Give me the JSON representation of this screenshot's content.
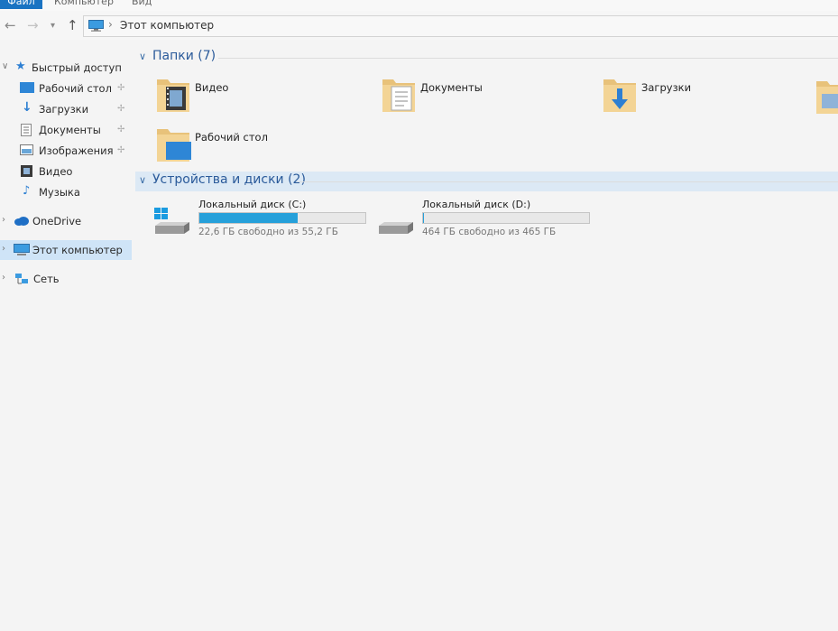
{
  "ribbon": {
    "tab_file": "Файл",
    "tab_computer": "Компьютер",
    "tab_view": "Вид"
  },
  "address": {
    "crumb": "Этот компьютер"
  },
  "nav": {
    "quick_access": "Быстрый доступ",
    "desktop": "Рабочий стол",
    "downloads": "Загрузки",
    "documents": "Документы",
    "pictures": "Изображения",
    "videos": "Видео",
    "music": "Музыка",
    "onedrive": "OneDrive",
    "this_pc": "Этот компьютер",
    "network": "Сеть"
  },
  "folders": {
    "header": "Папки (7)",
    "items": [
      "Видео",
      "Документы",
      "Загрузки",
      "Рабочий стол"
    ]
  },
  "devices": {
    "header": "Устройства и диски (2)",
    "drives": [
      {
        "name": "Локальный диск (C:)",
        "free": "22,6 ГБ свободно из 55,2 ГБ",
        "used_fraction": 0.59
      },
      {
        "name": "Локальный диск (D:)",
        "free": "464 ГБ свободно из 465 ГБ",
        "used_fraction": 0.002
      }
    ]
  },
  "colors": {
    "accent": "#1a73c2",
    "usage_bar": "#26a0da",
    "selection": "#cfe4f7",
    "group_header": "#2a5a9a"
  }
}
